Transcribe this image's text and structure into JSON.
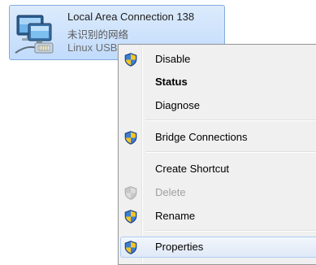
{
  "adapter": {
    "name": "Local Area Connection 138",
    "status": "未识别的网络",
    "device": "Linux USB",
    "icon": "network-adapter-icon"
  },
  "menu": {
    "items": [
      {
        "label": "Disable",
        "icon": "uac-shield-icon",
        "bold": false,
        "disabled": false
      },
      {
        "label": "Status",
        "icon": null,
        "bold": true,
        "disabled": false
      },
      {
        "label": "Diagnose",
        "icon": null,
        "bold": false,
        "disabled": false
      },
      {
        "label": "Bridge Connections",
        "icon": "uac-shield-icon",
        "bold": false,
        "disabled": false
      },
      {
        "label": "Create Shortcut",
        "icon": null,
        "bold": false,
        "disabled": false
      },
      {
        "label": "Delete",
        "icon": "uac-shield-icon",
        "bold": false,
        "disabled": true
      },
      {
        "label": "Rename",
        "icon": "uac-shield-icon",
        "bold": false,
        "disabled": false
      },
      {
        "label": "Properties",
        "icon": "uac-shield-icon",
        "bold": false,
        "disabled": false,
        "highlighted": true
      }
    ]
  },
  "colors": {
    "selection_fill": "#c9e0fc",
    "selection_border": "#84acdd",
    "menu_background": "#f0f0f0",
    "hover_border": "#aecff7",
    "disabled_text": "#a0a0a0"
  }
}
